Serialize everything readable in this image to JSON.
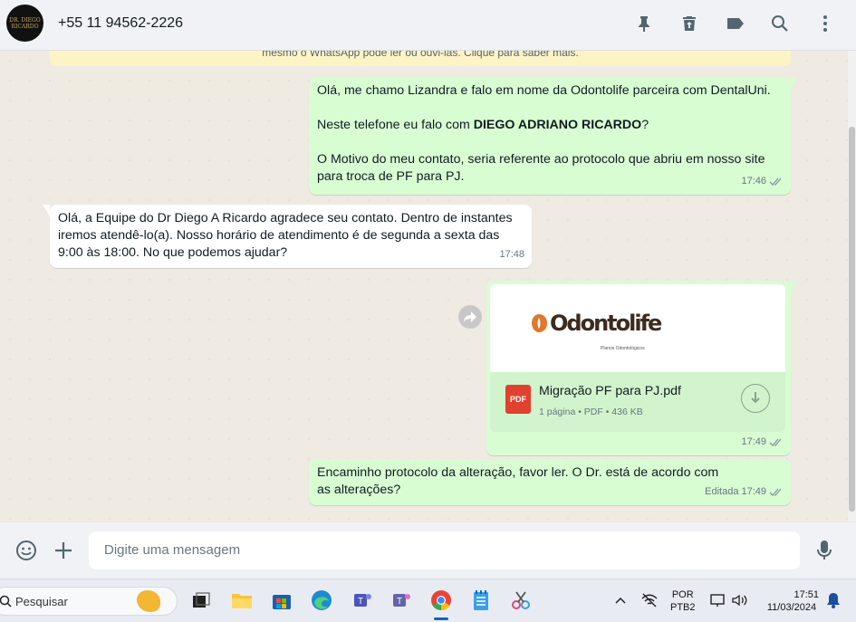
{
  "header": {
    "contact_name": "+55 11 94562-2226",
    "avatar_text": "DR. DIEGO RICARDO",
    "icons": [
      "pin-icon",
      "delete-icon",
      "label-icon",
      "search-icon",
      "menu-icon"
    ]
  },
  "chat": {
    "encryption_notice": "mesmo o WhatsApp pode ler ou ouvi-las. Clique para saber mais.",
    "msg1": {
      "line1": "Olá, me chamo Lizandra e falo em nome da Odontolife parceira com DentalUni.",
      "line2_prefix": "Neste telefone eu falo com ",
      "line2_bold": "DIEGO ADRIANO RICARDO",
      "line2_suffix": "?",
      "line3": "O Motivo do meu contato, seria referente ao protocolo que abriu em nosso site para troca de PF para PJ.",
      "time": "17:46"
    },
    "msg2": {
      "text": "Olá, a Equipe do Dr Diego A Ricardo agradece seu contato. Dentro de instantes iremos atendê-lo(a). Nosso horário de atendimento é de segunda a sexta das 9:00 às 18:00. No que podemos ajudar?",
      "time": "17:48"
    },
    "msg3": {
      "logo_text": "Odontolife",
      "logo_sub": "Planos Odontológicos",
      "file_name": "Migração PF para PJ.pdf",
      "file_meta": "1 página • PDF • 436 KB",
      "pdf_label": "PDF",
      "time": "17:49"
    },
    "msg4": {
      "text": "Encaminho protocolo da alteração, favor ler. O Dr. está de acordo com as alterações?",
      "edited": "Editada",
      "time": "17:49"
    }
  },
  "composer": {
    "placeholder": "Digite uma mensagem"
  },
  "taskbar": {
    "search_label": "Pesquisar",
    "lang": "POR",
    "layout": "PTB2",
    "time": "17:51",
    "date": "11/03/2024"
  }
}
